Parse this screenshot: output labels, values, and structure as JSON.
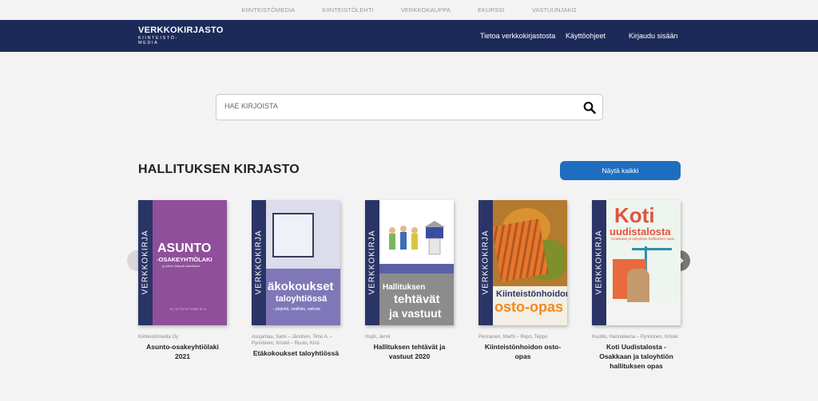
{
  "top_links": [
    "KIINTEISTÖMEDIA",
    "KIINTEISTÖLEHTI",
    "VERKKOKAUPPA",
    "EKURSSI",
    "VASTUUNJAKO"
  ],
  "brand": {
    "title": "VERKKOKIRJASTO",
    "subtitle": "KIINTEISTÖ-MEDIA"
  },
  "nav": {
    "about": "Tietoa verkkokirjastosta",
    "help": "Käyttöohjeet",
    "login": "Kirjaudu sisään"
  },
  "search": {
    "placeholder": "HAE KIRJOISTA"
  },
  "section": {
    "title": "HALLITUKSEN KIRJASTO",
    "show_all": "Näytä kaikki"
  },
  "books": [
    {
      "spine": "VERKKOKIRJA",
      "cover_lines": [
        "ASUNTO",
        "-OSAKEYHTIÖLAKI",
        "ja siihen liittyvät säädökset",
        "KIINTEISTÖMEDIA"
      ],
      "authors": "Kiinteistömedia Oy",
      "title": "Asunto-osakeyhtiölaki 2021"
    },
    {
      "spine": "VERKKOKIRJA",
      "cover_lines": [
        "äkokoukset",
        "taloyhtiössä",
        "– järjestä, osallistu, vaikuta"
      ],
      "authors": "Asujamaa, Sami – Järvinen, Timo A. – Pynnönen, Kristel – Ruutu, Kirsi",
      "title": "Etäkokoukset taloyhtiössä"
    },
    {
      "spine": "VERKKOKIRJA",
      "cover_lines": [
        "Hallituksen",
        "tehtävät",
        "ja vastuut"
      ],
      "authors": "Hupli, Jenni",
      "title": "Hallituksen tehtävät ja vastuut 2020"
    },
    {
      "spine": "VERKKOKIRJA",
      "cover_lines": [
        "Kiinteistönhoidon",
        "osto-opas"
      ],
      "authors": "Pennanen, Martti – Repo, Teppo",
      "title": "Kiinteistönhoidon osto-opas"
    },
    {
      "spine": "VERKKOKIRJA",
      "cover_lines": [
        "Koti",
        "uudistalosta",
        "Osakkaan ja taloyhtiön hallituksen opas"
      ],
      "authors": "Kuutilo, Hannaleena – Pynnönen, Kristel",
      "title": "Koti Uudistalosta - Osakkaan ja taloyhtiön hallituksen opas"
    }
  ]
}
